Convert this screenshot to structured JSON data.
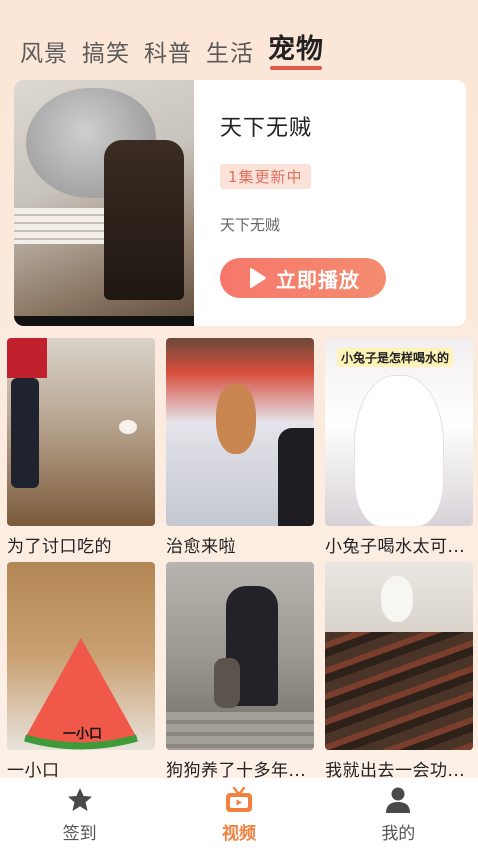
{
  "tabs": [
    {
      "label": "风景"
    },
    {
      "label": "搞笑"
    },
    {
      "label": "科普"
    },
    {
      "label": "生活"
    },
    {
      "label": "宠物"
    }
  ],
  "active_tab_index": 4,
  "feature": {
    "title": "天下无贼",
    "badge": "1集更新中",
    "subtitle": "天下无贼",
    "play_label": "立即播放"
  },
  "videos": [
    {
      "caption": "为了讨口吃的"
    },
    {
      "caption": "治愈来啦"
    },
    {
      "caption": "小兔子喝水太可..."
    },
    {
      "caption": "一小口",
      "overlay": "一小口"
    },
    {
      "caption": "狗狗养了十多年..."
    },
    {
      "caption": "我就出去一会功..."
    }
  ],
  "rabbit_overlay": "小兔子是怎样喝水的",
  "bottom_nav": [
    {
      "label": "签到",
      "icon": "star-icon"
    },
    {
      "label": "视频",
      "icon": "tv-icon"
    },
    {
      "label": "我的",
      "icon": "person-icon"
    }
  ],
  "colors": {
    "accent": "#f2803f",
    "play_button": "#f6776a",
    "tab_underline": "#e05a4a"
  }
}
